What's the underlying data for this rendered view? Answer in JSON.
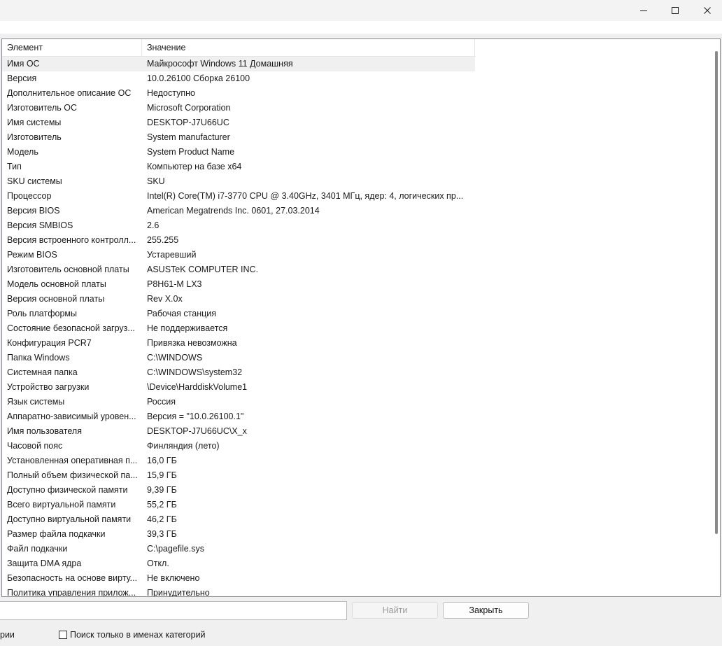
{
  "window": {
    "controls": [
      "minimize",
      "maximize",
      "close"
    ]
  },
  "list": {
    "columns": [
      "Элемент",
      "Значение"
    ],
    "selected_index": 0,
    "rows": [
      {
        "item": "Имя ОС",
        "value": "Майкрософт Windows 11 Домашняя"
      },
      {
        "item": "Версия",
        "value": "10.0.26100 Сборка 26100"
      },
      {
        "item": "Дополнительное описание ОС",
        "value": "Недоступно"
      },
      {
        "item": "Изготовитель ОС",
        "value": "Microsoft Corporation"
      },
      {
        "item": "Имя системы",
        "value": "DESKTOP-J7U66UC"
      },
      {
        "item": "Изготовитель",
        "value": "System manufacturer"
      },
      {
        "item": "Модель",
        "value": "System Product Name"
      },
      {
        "item": "Тип",
        "value": "Компьютер на базе x64"
      },
      {
        "item": "SKU системы",
        "value": "SKU"
      },
      {
        "item": "Процессор",
        "value": "Intel(R) Core(TM) i7-3770 CPU @ 3.40GHz, 3401 МГц, ядер: 4, логических пр..."
      },
      {
        "item": "Версия BIOS",
        "value": "American Megatrends Inc. 0601, 27.03.2014"
      },
      {
        "item": "Версия SMBIOS",
        "value": "2.6"
      },
      {
        "item": "Версия встроенного контролл...",
        "value": "255.255"
      },
      {
        "item": "Режим BIOS",
        "value": "Устаревший"
      },
      {
        "item": "Изготовитель основной платы",
        "value": "ASUSTeK COMPUTER INC."
      },
      {
        "item": "Модель основной платы",
        "value": "P8H61-M LX3"
      },
      {
        "item": "Версия основной платы",
        "value": "Rev X.0x"
      },
      {
        "item": "Роль платформы",
        "value": "Рабочая станция"
      },
      {
        "item": "Состояние безопасной загруз...",
        "value": "Не поддерживается"
      },
      {
        "item": "Конфигурация PCR7",
        "value": "Привязка невозможна"
      },
      {
        "item": "Папка Windows",
        "value": "C:\\WINDOWS"
      },
      {
        "item": "Системная папка",
        "value": "C:\\WINDOWS\\system32"
      },
      {
        "item": "Устройство загрузки",
        "value": "\\Device\\HarddiskVolume1"
      },
      {
        "item": "Язык системы",
        "value": "Россия"
      },
      {
        "item": "Аппаратно-зависимый уровен...",
        "value": "Версия = \"10.0.26100.1\""
      },
      {
        "item": "Имя пользователя",
        "value": "DESKTOP-J7U66UC\\X_x"
      },
      {
        "item": "Часовой пояс",
        "value": "Финляндия (лето)"
      },
      {
        "item": "Установленная оперативная п...",
        "value": "16,0 ГБ"
      },
      {
        "item": "Полный объем физической па...",
        "value": "15,9 ГБ"
      },
      {
        "item": "Доступно физической памяти",
        "value": "9,39 ГБ"
      },
      {
        "item": "Всего виртуальной памяти",
        "value": "55,2 ГБ"
      },
      {
        "item": "Доступно виртуальной памяти",
        "value": "46,2 ГБ"
      },
      {
        "item": "Размер файла подкачки",
        "value": "39,3 ГБ"
      },
      {
        "item": "Файл подкачки",
        "value": "C:\\pagefile.sys"
      },
      {
        "item": "Защита DMA ядра",
        "value": "Откл."
      },
      {
        "item": "Безопасность на основе вирту...",
        "value": "Не включено"
      },
      {
        "item": "Политика управления прилож...",
        "value": "Принудительно"
      }
    ]
  },
  "search": {
    "value": "",
    "find_label": "Найти",
    "close_label": "Закрыть"
  },
  "bottom": {
    "left_text": "рии",
    "checkbox_label": "Поиск только в именах категорий",
    "checkbox_checked": false
  }
}
